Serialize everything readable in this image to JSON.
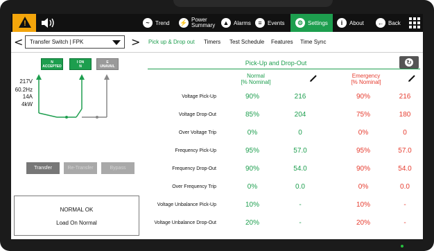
{
  "nav": {
    "items": [
      {
        "id": "trend",
        "label": "Trend",
        "icon": "trend-icon"
      },
      {
        "id": "power",
        "label_line1": "Power",
        "label_line2": "Summary",
        "icon": "power-icon"
      },
      {
        "id": "alarms",
        "label": "Alarms",
        "icon": "alarm-icon"
      },
      {
        "id": "events",
        "label": "Events",
        "icon": "events-icon"
      },
      {
        "id": "settings",
        "label": "Settings",
        "icon": "settings-icon",
        "active": true
      },
      {
        "id": "about",
        "label": "About",
        "icon": "info-icon"
      },
      {
        "id": "back",
        "label": "Back",
        "icon": "back-arrow-icon"
      }
    ],
    "warning_icon": "warning-icon",
    "speaker_icon": "speaker-icon",
    "menu_icon": "grid-menu-icon",
    "colors": {
      "bar": "#111111",
      "active": "#1d9e4e",
      "warning": "#f3a50b"
    }
  },
  "subheader": {
    "prev": "<",
    "next": ">",
    "device": "Transfer Switch | FPK",
    "tabs": [
      {
        "label": "Pick up & Drop out",
        "active": true
      },
      {
        "label": "Timers"
      },
      {
        "label": "Test Schedule"
      },
      {
        "label": "Features"
      },
      {
        "label": "Time Sync"
      }
    ]
  },
  "left": {
    "indicators": [
      {
        "line1": "N",
        "line2": "ACCEPTED",
        "state": "green"
      },
      {
        "line1": "I ON",
        "line2": "N",
        "state": "green"
      },
      {
        "line1": "E",
        "line2": "UNAVAIL",
        "state": "gray"
      }
    ],
    "readings": [
      "217V",
      "60.2Hz",
      "14A",
      "4kW"
    ],
    "buttons": [
      {
        "label": "Transfer",
        "enabled": true
      },
      {
        "label": "Re-Transfer",
        "enabled": false
      },
      {
        "label": "Bypass",
        "enabled": false
      }
    ],
    "status_line1": "NORMAL OK",
    "status_line2": "Load On Normal"
  },
  "right": {
    "title": "Pick-Up and Drop-Out",
    "sync_icon": "sync-icon",
    "edit_icon": "pencil-icon",
    "normal_header": [
      "Normal",
      "[% Nominal]"
    ],
    "emergency_header": [
      "Emergency",
      "[% Nominal]"
    ],
    "colors": {
      "normal": "#1d9e4e",
      "emergency": "#e63b2e"
    },
    "rows": [
      {
        "label": "Voltage Pick-Up",
        "normal_pct": "90%",
        "normal_val": "216",
        "emerg_pct": "90%",
        "emerg_val": "216"
      },
      {
        "label": "Voltage Drop-Out",
        "normal_pct": "85%",
        "normal_val": "204",
        "emerg_pct": "75%",
        "emerg_val": "180"
      },
      {
        "label": "Over Voltage Trip",
        "normal_pct": "0%",
        "normal_val": "0",
        "emerg_pct": "0%",
        "emerg_val": "0"
      },
      {
        "label": "Frequency Pick-Up",
        "normal_pct": "95%",
        "normal_val": "57.0",
        "emerg_pct": "95%",
        "emerg_val": "57.0"
      },
      {
        "label": "Frequency Drop-Out",
        "normal_pct": "90%",
        "normal_val": "54.0",
        "emerg_pct": "90%",
        "emerg_val": "54.0"
      },
      {
        "label": "Over Frequency Trip",
        "normal_pct": "0%",
        "normal_val": "0.0",
        "emerg_pct": "0%",
        "emerg_val": "0.0"
      },
      {
        "label": "Voltage Unbalance Pick-Up",
        "normal_pct": "10%",
        "normal_val": "-",
        "emerg_pct": "10%",
        "emerg_val": "-"
      },
      {
        "label": "Voltage Unbalance Drop-Out",
        "normal_pct": "20%",
        "normal_val": "-",
        "emerg_pct": "20%",
        "emerg_val": "-"
      }
    ]
  }
}
